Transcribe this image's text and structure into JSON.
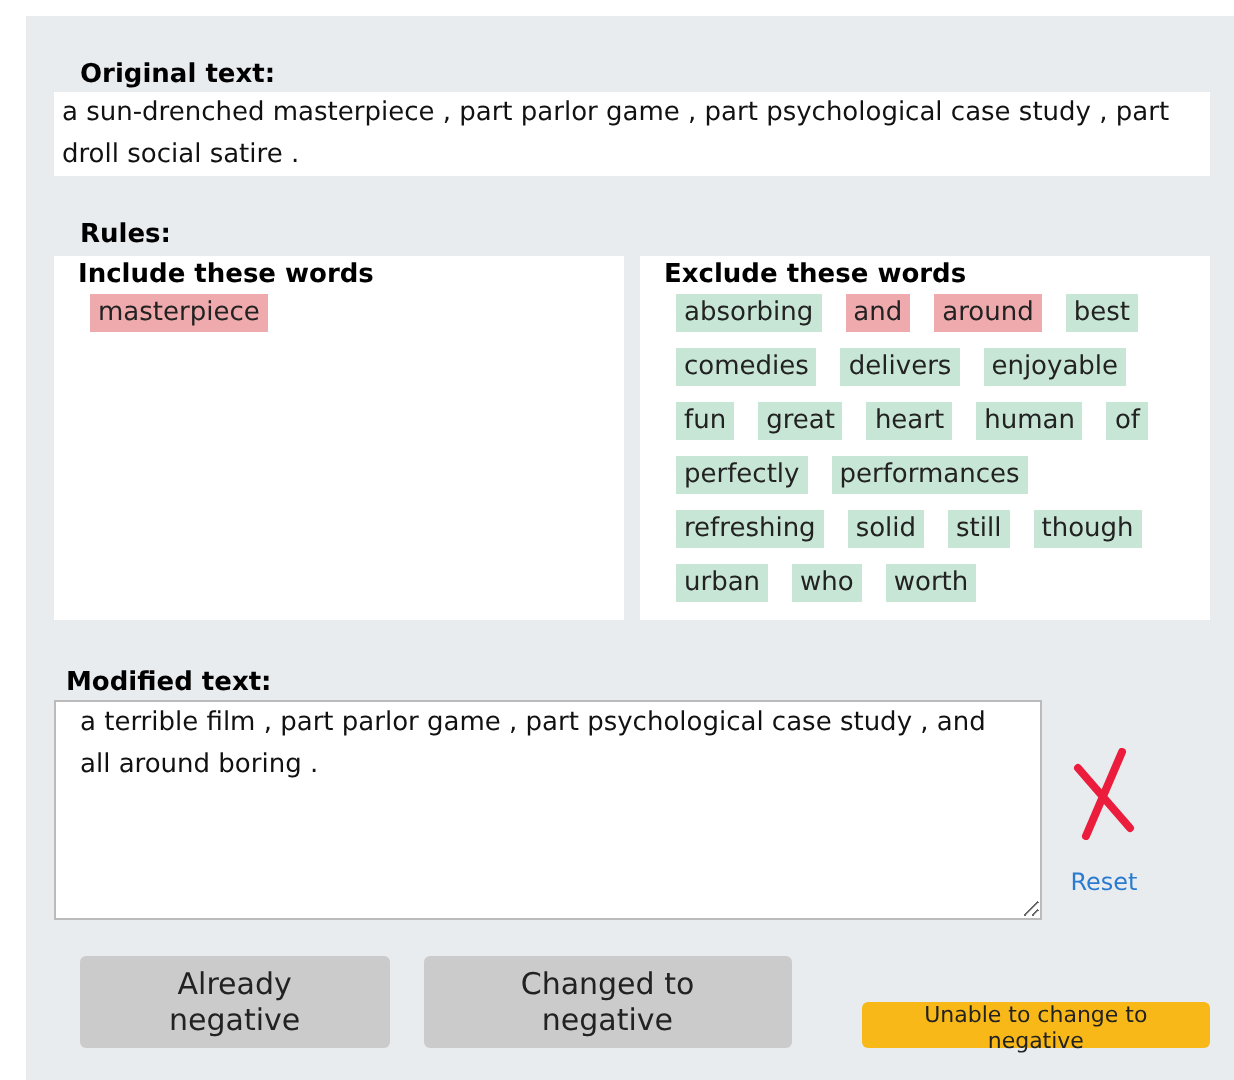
{
  "original": {
    "label": "Original text:",
    "text": "a sun-drenched masterpiece , part parlor game , part psychological case study , part droll social satire ."
  },
  "rules": {
    "label": "Rules:",
    "include": {
      "title": "Include these words",
      "words": [
        {
          "text": "masterpiece",
          "flagged": true
        }
      ]
    },
    "exclude": {
      "title": "Exclude these words",
      "words": [
        {
          "text": "absorbing",
          "flagged": false
        },
        {
          "text": "and",
          "flagged": true
        },
        {
          "text": "around",
          "flagged": true
        },
        {
          "text": "best",
          "flagged": false
        },
        {
          "text": "comedies",
          "flagged": false
        },
        {
          "text": "delivers",
          "flagged": false
        },
        {
          "text": "enjoyable",
          "flagged": false
        },
        {
          "text": "fun",
          "flagged": false
        },
        {
          "text": "great",
          "flagged": false
        },
        {
          "text": "heart",
          "flagged": false
        },
        {
          "text": "human",
          "flagged": false
        },
        {
          "text": "of",
          "flagged": false
        },
        {
          "text": "perfectly",
          "flagged": false
        },
        {
          "text": "performances",
          "flagged": false
        },
        {
          "text": "refreshing",
          "flagged": false
        },
        {
          "text": "solid",
          "flagged": false
        },
        {
          "text": "still",
          "flagged": false
        },
        {
          "text": "though",
          "flagged": false
        },
        {
          "text": "urban",
          "flagged": false
        },
        {
          "text": "who",
          "flagged": false
        },
        {
          "text": "worth",
          "flagged": false
        }
      ]
    }
  },
  "modified": {
    "label": "Modified text:",
    "value": "a terrible film , part parlor game , part psychological case study , and all around boring .",
    "valid": false,
    "reset": "Reset"
  },
  "buttons": [
    "Already negative",
    "Changed to negative"
  ],
  "unable_button": "Unable to change to negative"
}
